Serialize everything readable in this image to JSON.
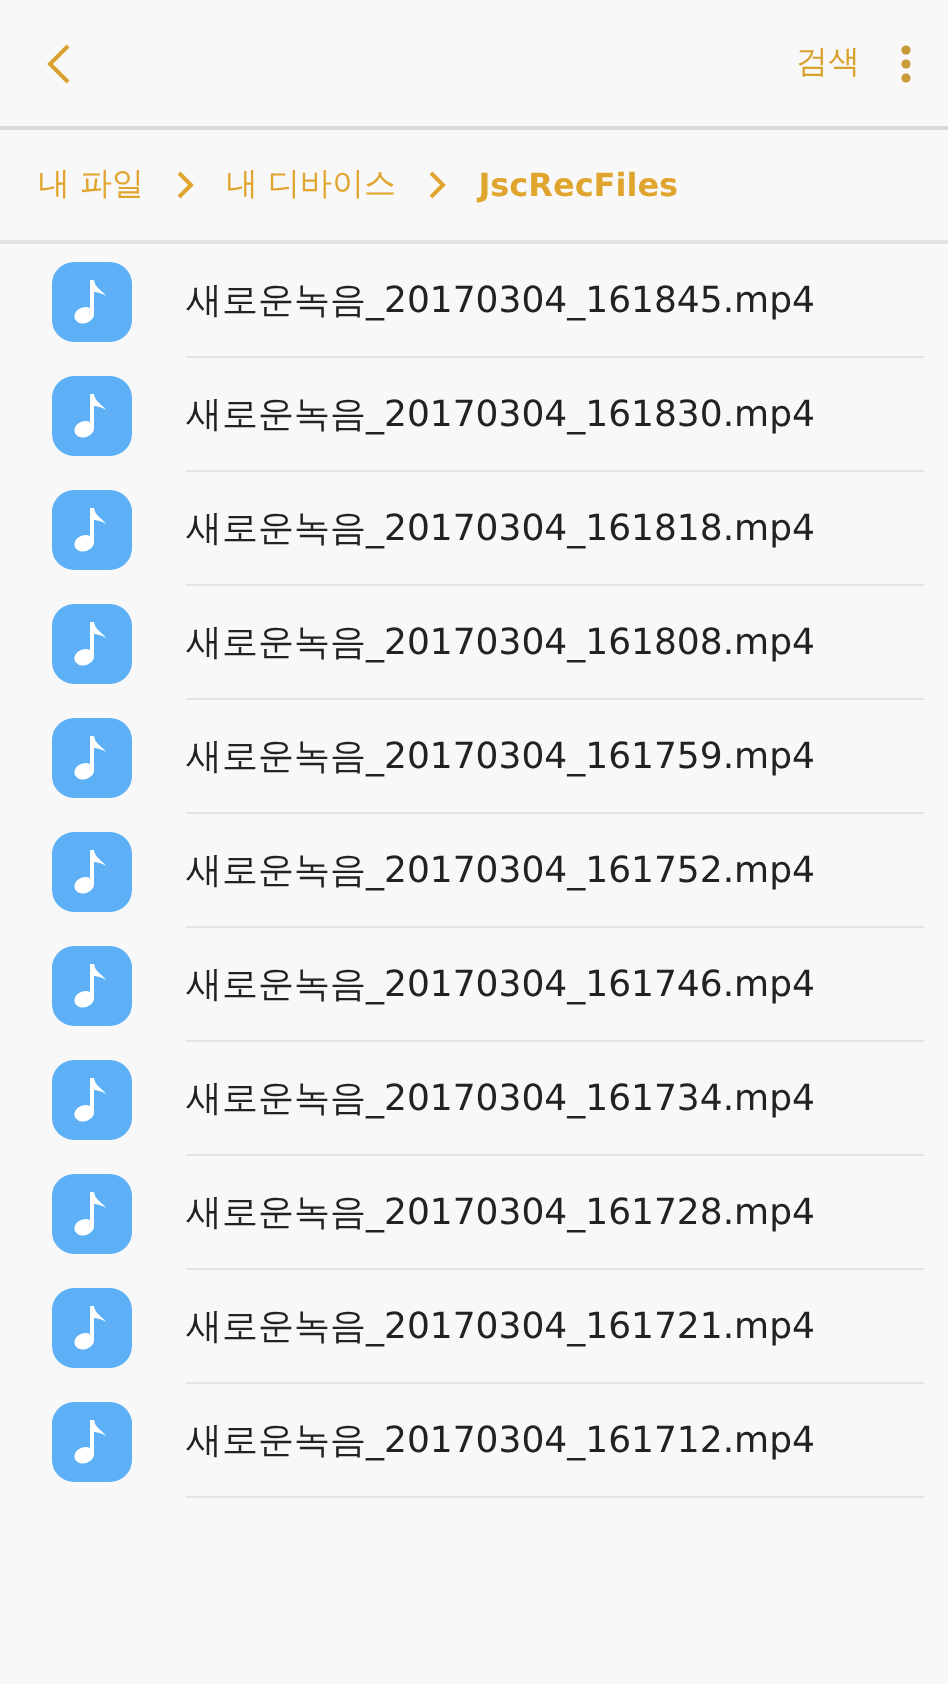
{
  "toolbar": {
    "action": "검색"
  },
  "breadcrumbs": [
    {
      "label": "내 파일",
      "current": false
    },
    {
      "label": "내 디바이스",
      "current": false
    },
    {
      "label": "JscRecFiles",
      "current": true
    }
  ],
  "files": [
    {
      "name": "새로운녹음_20170304_161845.mp4"
    },
    {
      "name": "새로운녹음_20170304_161830.mp4"
    },
    {
      "name": "새로운녹음_20170304_161818.mp4"
    },
    {
      "name": "새로운녹음_20170304_161808.mp4"
    },
    {
      "name": "새로운녹음_20170304_161759.mp4"
    },
    {
      "name": "새로운녹음_20170304_161752.mp4"
    },
    {
      "name": "새로운녹음_20170304_161746.mp4"
    },
    {
      "name": "새로운녹음_20170304_161734.mp4"
    },
    {
      "name": "새로운녹음_20170304_161728.mp4"
    },
    {
      "name": "새로운녹음_20170304_161721.mp4"
    },
    {
      "name": "새로운녹음_20170304_161712.mp4"
    }
  ]
}
